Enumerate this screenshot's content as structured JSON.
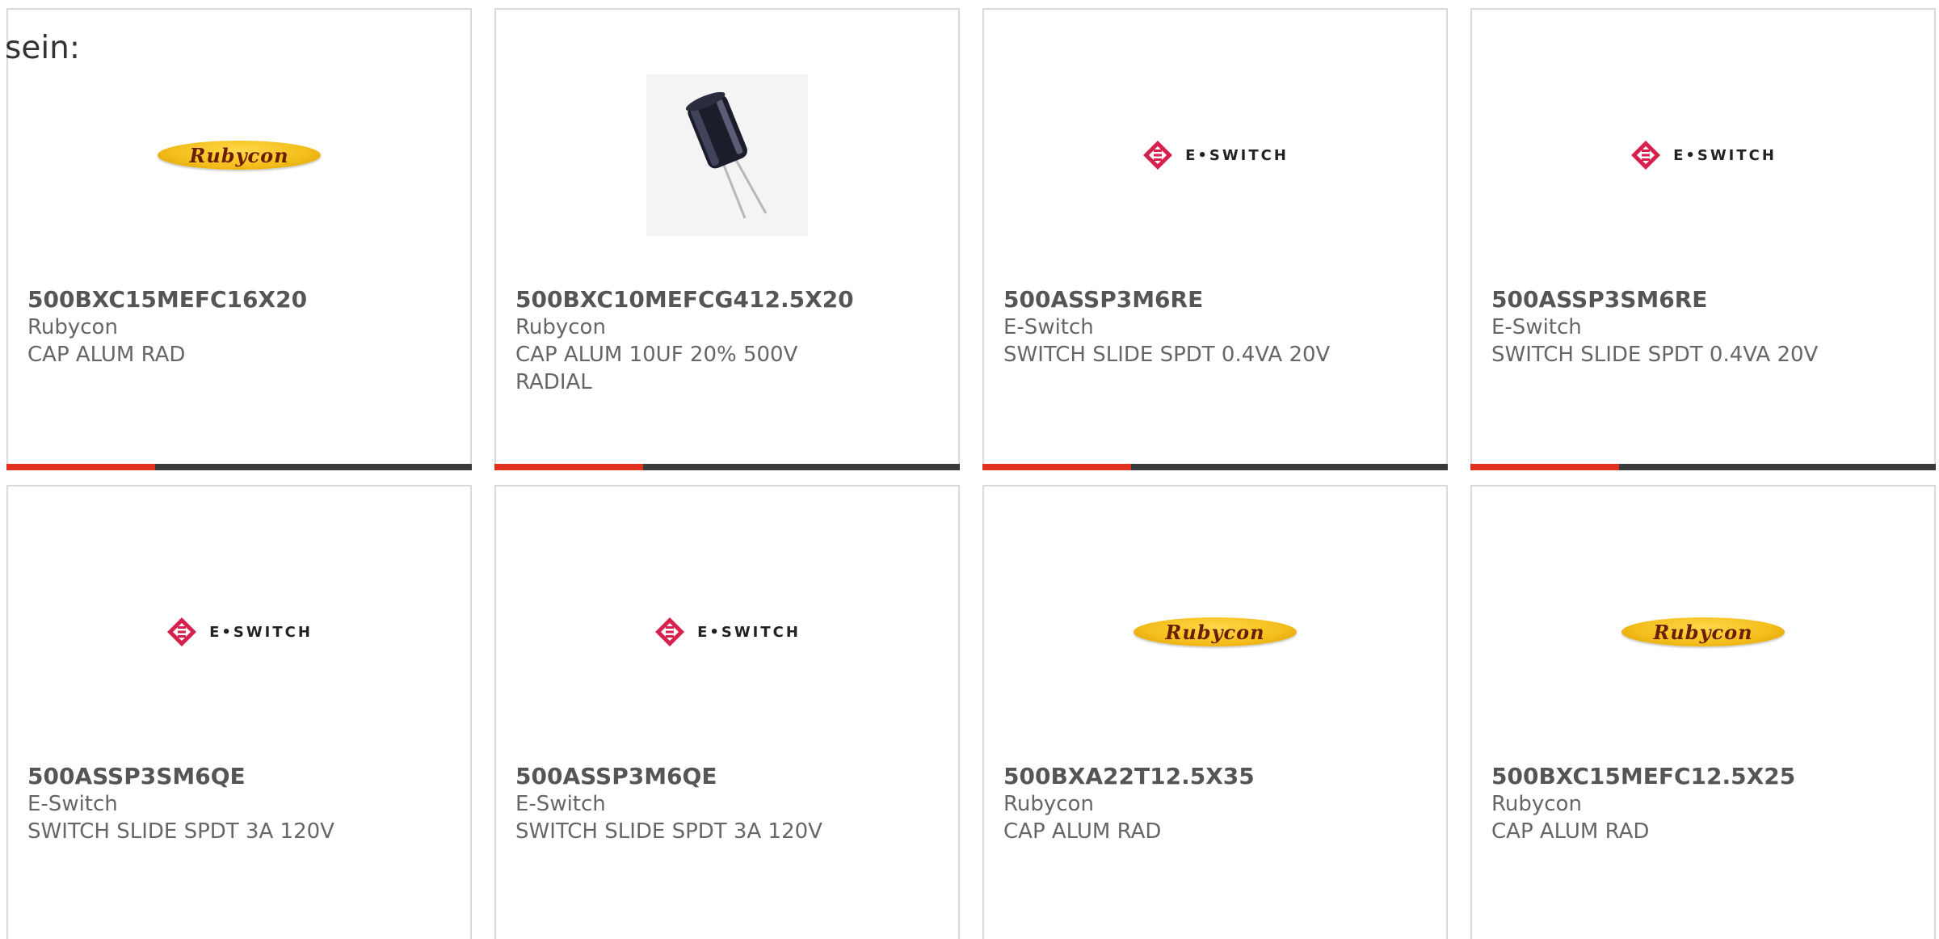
{
  "intro_text": "sein:",
  "colors": {
    "accent": "#e0301e",
    "bar_track": "#3a3a3a",
    "card_border": "#d9d9d9",
    "rubycon_gold": "#f3bd1a",
    "eswitch_red": "#d6214f"
  },
  "products": [
    {
      "part_number": "500BXC15MEFC16X20",
      "manufacturer": "Rubycon",
      "description": "CAP ALUM RAD",
      "image": "rubycon-logo",
      "logo_text": "Rubycon",
      "progress": 0.32
    },
    {
      "part_number": "500BXC10MEFCG412.5X20",
      "manufacturer": "Rubycon",
      "description": "CAP ALUM 10UF 20% 500V RADIAL",
      "image": "capacitor-photo",
      "progress": 0.32
    },
    {
      "part_number": "500ASSP3M6RE",
      "manufacturer": "E-Switch",
      "description": "SWITCH SLIDE SPDT 0.4VA 20V",
      "image": "eswitch-logo",
      "logo_text": "E•SWITCH",
      "progress": 0.32
    },
    {
      "part_number": "500ASSP3SM6RE",
      "manufacturer": "E-Switch",
      "description": "SWITCH SLIDE SPDT 0.4VA 20V",
      "image": "eswitch-logo",
      "logo_text": "E•SWITCH",
      "progress": 0.32
    },
    {
      "part_number": "500ASSP3SM6QE",
      "manufacturer": "E-Switch",
      "description": "SWITCH SLIDE SPDT 3A 120V",
      "image": "eswitch-logo",
      "logo_text": "E•SWITCH"
    },
    {
      "part_number": "500ASSP3M6QE",
      "manufacturer": "E-Switch",
      "description": "SWITCH SLIDE SPDT 3A 120V",
      "image": "eswitch-logo",
      "logo_text": "E•SWITCH"
    },
    {
      "part_number": "500BXA22T12.5X35",
      "manufacturer": "Rubycon",
      "description": "CAP ALUM RAD",
      "image": "rubycon-logo",
      "logo_text": "Rubycon"
    },
    {
      "part_number": "500BXC15MEFC12.5X25",
      "manufacturer": "Rubycon",
      "description": "CAP ALUM RAD",
      "image": "rubycon-logo",
      "logo_text": "Rubycon"
    }
  ]
}
